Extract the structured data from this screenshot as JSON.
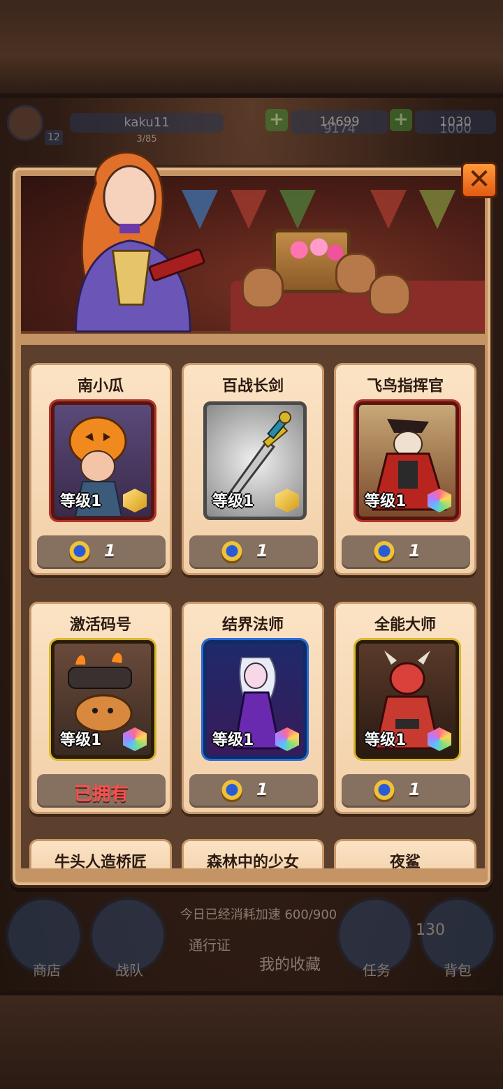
{
  "background": {
    "player_name": "kaku11",
    "player_level": "12",
    "player_exp": "3/85",
    "currency_a": "14699",
    "currency_a_sub": "9174",
    "currency_b": "1030",
    "currency_b_sub": "1000",
    "hint": "今日已经消耗加速 600/900",
    "nav": {
      "shop": "商店",
      "team": "战队",
      "pass": "通行证",
      "collection": "我的收藏",
      "quest": "任务",
      "bag": "背包",
      "bag_count": "130"
    }
  },
  "modal": {
    "close_label": "✕",
    "level_text": "等级1",
    "cards": [
      {
        "name": "南小瓜",
        "rarity": "gold",
        "frame": "red",
        "price": "1",
        "owned": false,
        "art": "pumpkin-hero"
      },
      {
        "name": "百战长剑",
        "rarity": "gold",
        "frame": "silver",
        "price": "1",
        "owned": false,
        "art": "sword"
      },
      {
        "name": "飞鸟指挥官",
        "rarity": "multi",
        "frame": "red",
        "price": "1",
        "owned": false,
        "art": "bird-commander"
      },
      {
        "name": "激活码号",
        "rarity": "multi",
        "frame": "gold",
        "price": "",
        "owned": true,
        "owned_label": "已拥有",
        "art": "cannon-cat"
      },
      {
        "name": "结界法师",
        "rarity": "multi",
        "frame": "blue",
        "price": "1",
        "owned": false,
        "art": "barrier-mage"
      },
      {
        "name": "全能大师",
        "rarity": "multi",
        "frame": "gold",
        "price": "1",
        "owned": false,
        "art": "omni-master"
      }
    ],
    "partial_cards": [
      {
        "name": "牛头人造桥匠"
      },
      {
        "name": "森林中的少女"
      },
      {
        "name": "夜鲨"
      }
    ]
  }
}
